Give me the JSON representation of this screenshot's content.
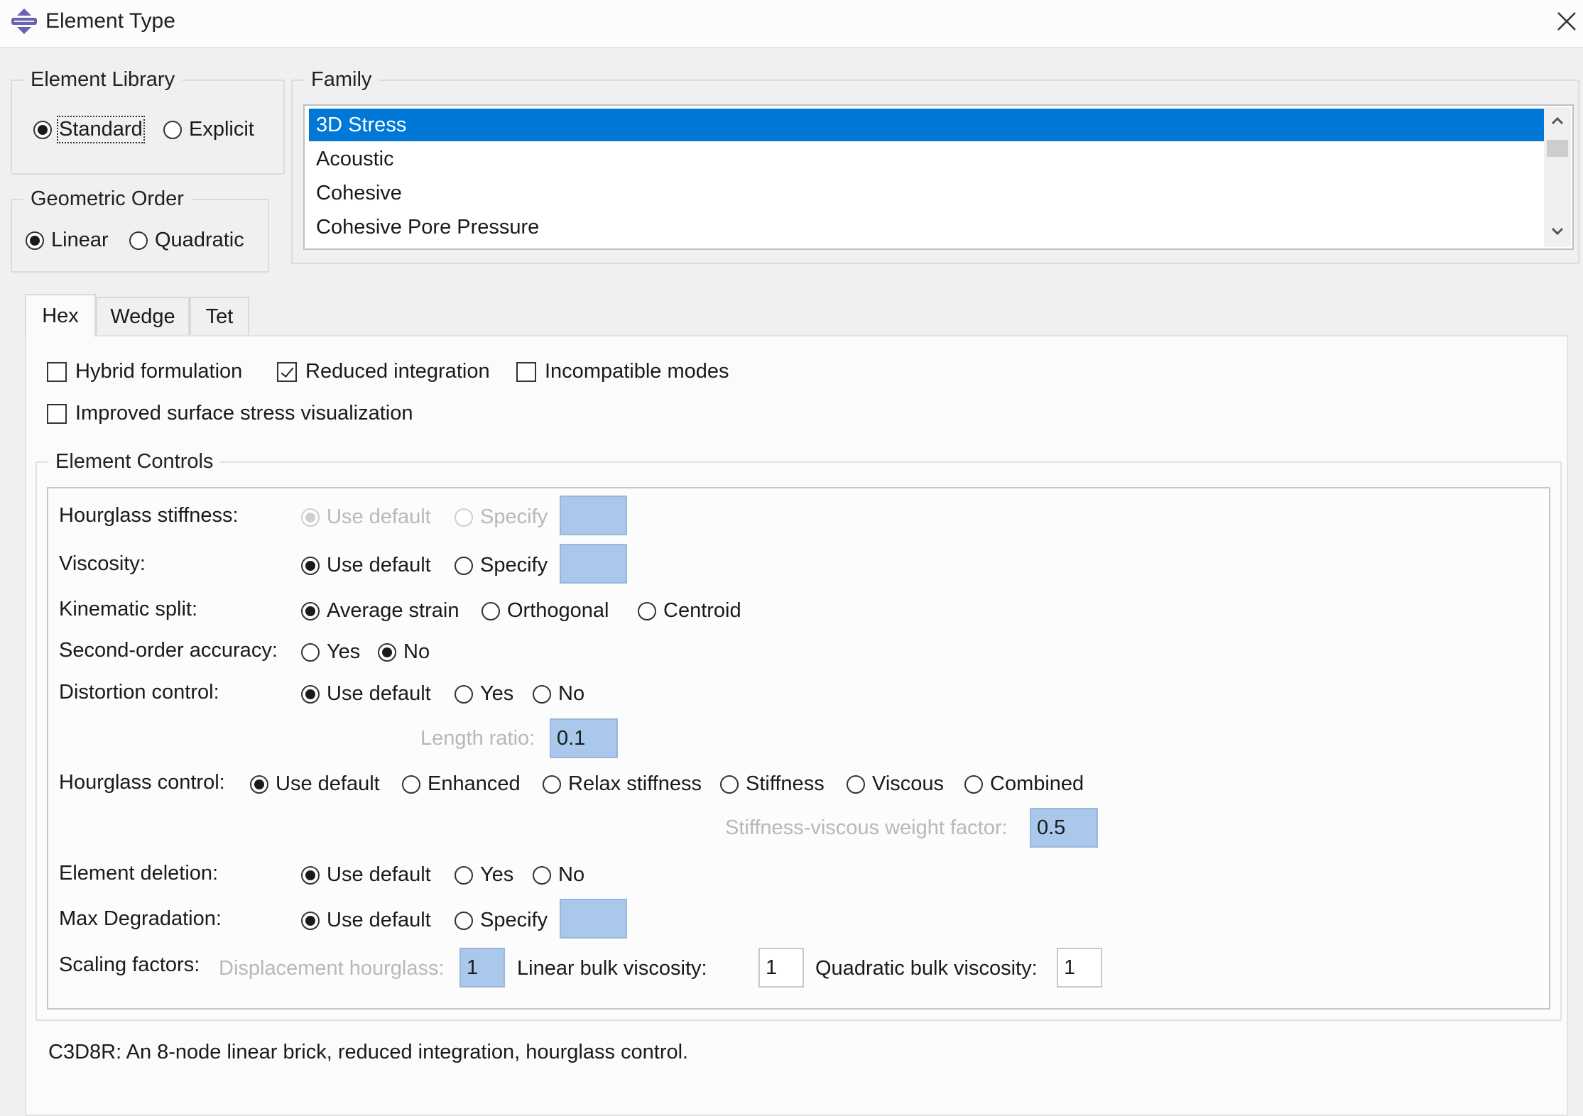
{
  "window": {
    "title": "Element Type",
    "icon": "abaqus-app-icon",
    "close_icon": "close-icon"
  },
  "element_library": {
    "legend": "Element Library",
    "options": [
      {
        "label": "Standard",
        "selected": true
      },
      {
        "label": "Explicit",
        "selected": false
      }
    ]
  },
  "geometric_order": {
    "legend": "Geometric Order",
    "options": [
      {
        "label": "Linear",
        "selected": true
      },
      {
        "label": "Quadratic",
        "selected": false
      }
    ]
  },
  "family": {
    "legend": "Family",
    "items": [
      "3D Stress",
      "Acoustic",
      "Cohesive",
      "Cohesive Pore Pressure"
    ],
    "selected": "3D Stress"
  },
  "tabs": [
    {
      "label": "Hex",
      "active": true
    },
    {
      "label": "Wedge",
      "active": false
    },
    {
      "label": "Tet",
      "active": false
    }
  ],
  "options": {
    "hybrid": {
      "label": "Hybrid formulation",
      "checked": false
    },
    "reduced": {
      "label": "Reduced integration",
      "checked": true
    },
    "incompatible": {
      "label": "Incompatible modes",
      "checked": false
    },
    "improved": {
      "label": "Improved surface stress visualization",
      "checked": false
    }
  },
  "element_controls": {
    "legend": "Element Controls",
    "hourglass_stiffness": {
      "label": "Hourglass stiffness:",
      "use_default": "Use default",
      "specify": "Specify",
      "value": "",
      "disabled": true
    },
    "viscosity": {
      "label": "Viscosity:",
      "use_default": "Use default",
      "specify": "Specify",
      "value": ""
    },
    "kinematic_split": {
      "label": "Kinematic split:",
      "options": [
        "Average strain",
        "Orthogonal",
        "Centroid"
      ],
      "selected": "Average strain"
    },
    "second_order": {
      "label": "Second-order accuracy:",
      "options": [
        "Yes",
        "No"
      ],
      "selected": "No"
    },
    "distortion_control": {
      "label": "Distortion control:",
      "options": [
        "Use default",
        "Yes",
        "No"
      ],
      "selected": "Use default"
    },
    "length_ratio": {
      "label": "Length ratio:",
      "value": "0.1"
    },
    "hourglass_control": {
      "label": "Hourglass control:",
      "options": [
        "Use default",
        "Enhanced",
        "Relax stiffness",
        "Stiffness",
        "Viscous",
        "Combined"
      ],
      "selected": "Use default"
    },
    "sv_weight": {
      "label": "Stiffness-viscous weight factor:",
      "value": "0.5"
    },
    "element_deletion": {
      "label": "Element deletion:",
      "options": [
        "Use default",
        "Yes",
        "No"
      ],
      "selected": "Use default"
    },
    "max_degradation": {
      "label": "Max Degradation:",
      "use_default": "Use default",
      "specify": "Specify",
      "value": ""
    },
    "scaling": {
      "label": "Scaling factors:",
      "displacement_label": "Displacement hourglass:",
      "displacement_value": "1",
      "linear_label": "Linear bulk viscosity:",
      "linear_value": "1",
      "quadratic_label": "Quadratic bulk viscosity:",
      "quadratic_value": "1"
    }
  },
  "description": "C3D8R:  An 8-node linear brick, reduced integration, hourglass control.",
  "colors": {
    "selection": "#0078d7",
    "field_disabled": "#a9c8ec"
  }
}
